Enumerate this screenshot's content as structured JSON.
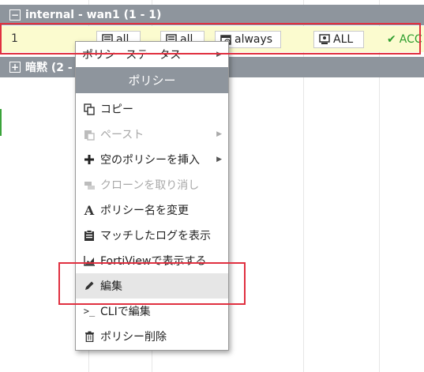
{
  "table": {
    "group1": {
      "toggle": "−",
      "label": "internal - wan1 (1 - 1)"
    },
    "row": {
      "id": "1",
      "source": "all",
      "destination": "all",
      "schedule": "always",
      "service": "ALL",
      "action": "ACC"
    },
    "group2": {
      "toggle": "+",
      "label": "暗黙 (2 - 2"
    }
  },
  "context_menu": {
    "top_item": "ポリシーステータス",
    "section_header": "ポリシー",
    "items": [
      {
        "label": "コピー",
        "icon": "copy-icon",
        "enabled": true,
        "submenu": false
      },
      {
        "label": "ペースト",
        "icon": "paste-icon",
        "enabled": false,
        "submenu": true
      },
      {
        "label": "空のポリシーを挿入",
        "icon": "plus-icon",
        "enabled": true,
        "submenu": true
      },
      {
        "label": "クローンを取り消し",
        "icon": "clone-icon",
        "enabled": false,
        "submenu": false
      },
      {
        "label": "ポリシー名を変更",
        "icon": "rename-icon",
        "enabled": true,
        "submenu": false
      },
      {
        "label": "マッチしたログを表示",
        "icon": "log-icon",
        "enabled": true,
        "submenu": false
      },
      {
        "label": "FortiViewで表示する",
        "icon": "chart-icon",
        "enabled": true,
        "submenu": false
      },
      {
        "label": "編集",
        "icon": "pencil-icon",
        "enabled": true,
        "submenu": false,
        "hovered": true
      },
      {
        "label": "CLIで編集",
        "icon": "terminal-icon",
        "enabled": true,
        "submenu": false
      },
      {
        "label": "ポリシー削除",
        "icon": "trash-icon",
        "enabled": true,
        "submenu": false
      }
    ]
  },
  "colors": {
    "group_header": "#8e959d",
    "row_selected": "#fbfbcf",
    "highlight": "#e03040",
    "accept_green": "#2e9e2e"
  }
}
